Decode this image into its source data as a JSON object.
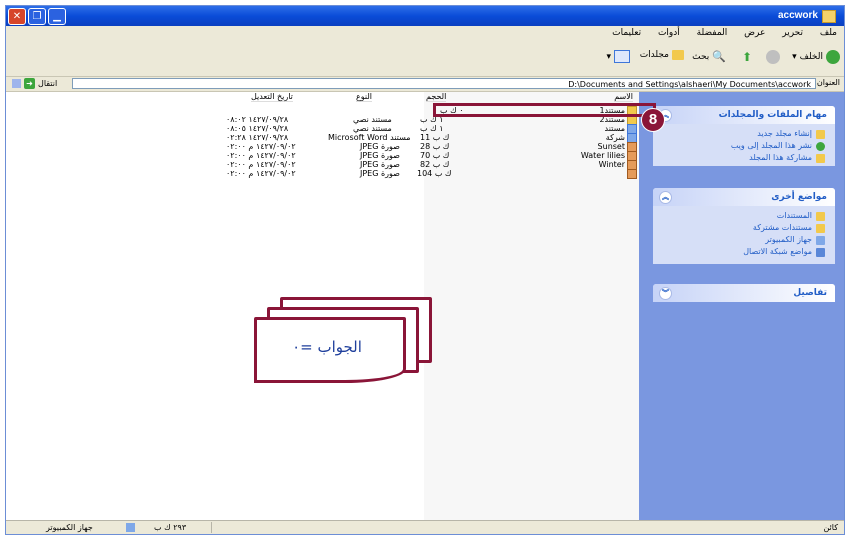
{
  "window": {
    "title": "accwork"
  },
  "menu": [
    "ملف",
    "تحرير",
    "عرض",
    "المفضلة",
    "أدوات",
    "تعليمات"
  ],
  "toolbar": {
    "back": "الخلف",
    "search": "بحث",
    "folders": "مجلدات"
  },
  "address": {
    "label": "العنوان",
    "path": "D:\\Documents and Settings\\alshaeri\\My Documents\\accwork",
    "go": "انتقال"
  },
  "columns": {
    "name": "الاسم",
    "size": "الحجم",
    "type": "النوع",
    "date": "تاريخ التعديل"
  },
  "files": [
    {
      "name": "مستند1",
      "size": "٠ ك ب",
      "type": "",
      "date": ""
    },
    {
      "name": "مستند2",
      "size": "١ ك ب",
      "type": "مستند نصي",
      "date": "١٤٢٧/٠٩/٢٨ ٠٨:٠٢"
    },
    {
      "name": "مستند",
      "size": "١ ك ب",
      "type": "مستند نصي",
      "date": "١٤٢٧/٠٩/٢٨ ٠٨:٠٥"
    },
    {
      "name": "شركة",
      "size": "11 ك ب",
      "type": "Microsoft Word مستند",
      "date": "١٤٢٧/٠٩/٢٨ ٠٢:٢٨"
    },
    {
      "name": "Sunset",
      "size": "28 ك ب",
      "type": "JPEG صورة",
      "date": "١٤٢٧/٠٩/٠٢ م ٠٢:٠٠"
    },
    {
      "name": "Water lilies",
      "size": "70 ك ب",
      "type": "JPEG صورة",
      "date": "١٤٢٧/٠٩/٠٢ م ٠٢:٠٠"
    },
    {
      "name": "Winter",
      "size": "82 ك ب",
      "type": "JPEG صورة",
      "date": "١٤٢٧/٠٩/٠٢ م ٠٢:٠٠"
    },
    {
      "name": "",
      "size": "104 ك ب",
      "type": "JPEG صورة",
      "date": "١٤٢٧/٠٩/٠٢ م ٠٢:٠٠"
    }
  ],
  "taskpane": {
    "file_tasks": {
      "title": "مهام الملفات والمجلدات",
      "items": [
        "إنشاء مجلد جديد",
        "نشر هذا المجلد إلى ويب",
        "مشاركة هذا المجلد"
      ]
    },
    "other_places": {
      "title": "مواضع أخرى",
      "items": [
        "المستندات",
        "مستندات مشتركة",
        "جهاز الكمبيوتر",
        "مواضع شبكة الاتصال"
      ]
    },
    "details": {
      "title": "تفاصيل"
    }
  },
  "callout": {
    "badge": "8",
    "answer": "الجواب =٠"
  },
  "status": {
    "left": "جهاز الكمبيوتر",
    "size": "٢٩٣ ك ب",
    "right": "كائن"
  }
}
